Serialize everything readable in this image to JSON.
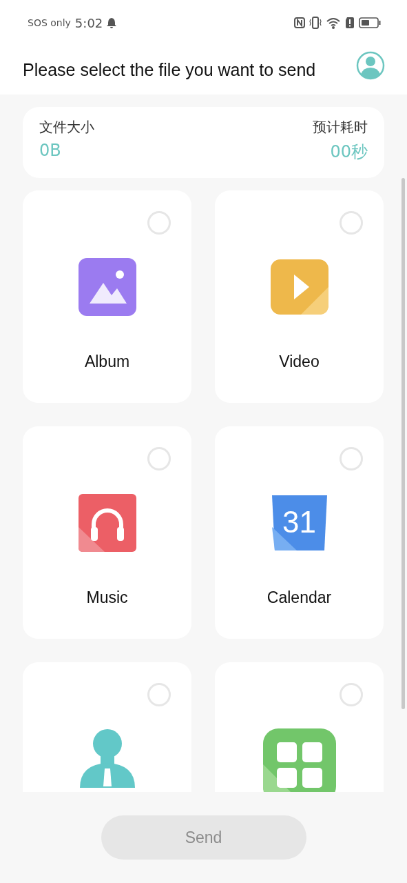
{
  "status_bar": {
    "carrier": "SOS only",
    "time": "5:02"
  },
  "header": {
    "title": "Please select the file you want to send"
  },
  "summary": {
    "size_label": "文件大小",
    "size_value": "0B",
    "time_label": "预计耗时",
    "time_value": "00秒"
  },
  "category_rows": [
    {
      "items": [
        {
          "kind": "album",
          "label": "Album",
          "selected": false
        },
        {
          "kind": "video",
          "label": "Video",
          "selected": false
        }
      ]
    },
    {
      "items": [
        {
          "kind": "music",
          "label": "Music",
          "selected": false
        },
        {
          "kind": "calendar",
          "label": "Calendar",
          "icon_text": "31",
          "selected": false
        }
      ]
    },
    {
      "items": [
        {
          "kind": "contacts",
          "selected": false
        },
        {
          "kind": "apps",
          "selected": false
        }
      ]
    }
  ],
  "send_button": {
    "label": "Send",
    "disabled": true
  }
}
